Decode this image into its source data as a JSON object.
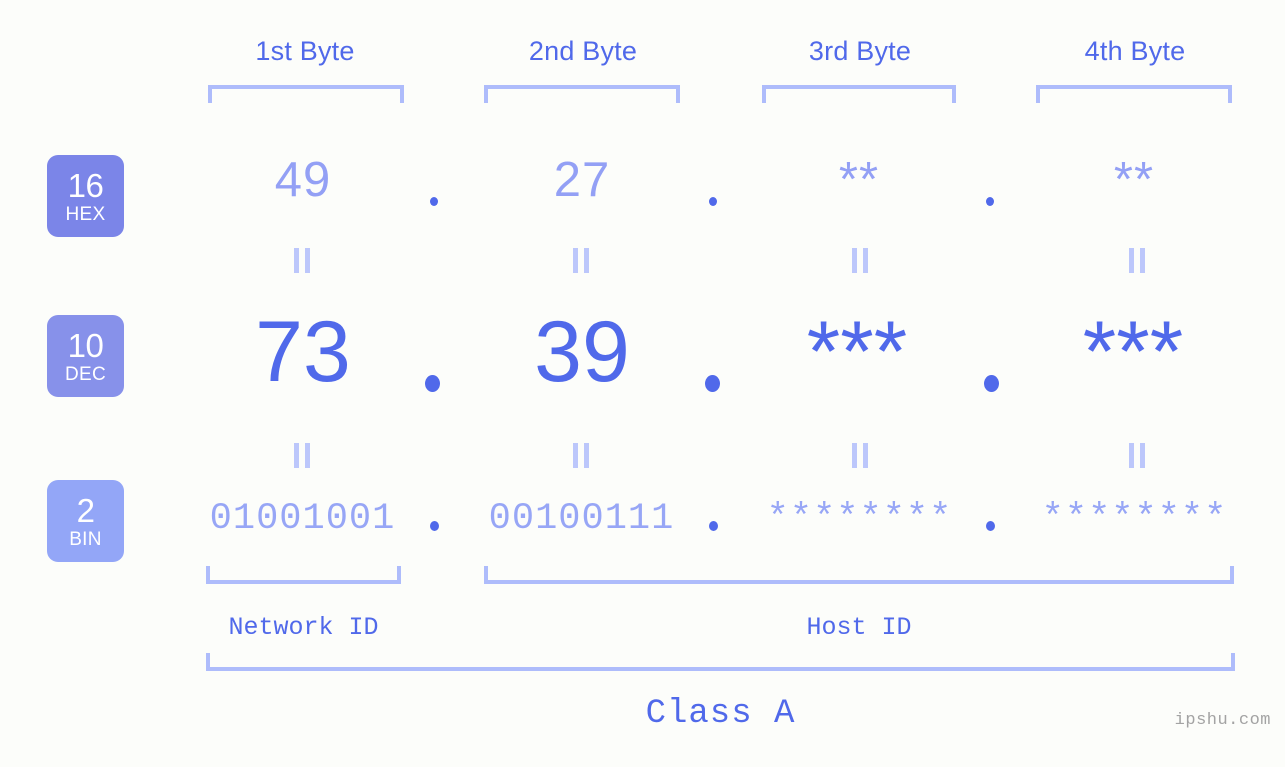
{
  "background_color": "#fcfdfa",
  "colors": {
    "accent_strong": "#5069ea",
    "accent_light": "#a8b4fb",
    "badge_hex": "#7b85e8",
    "badge_dec": "#8791ea",
    "badge_bin": "#93a6f7",
    "bracket": "#aebcfb",
    "equals_mark": "#bcc7fb",
    "watermark": "#a3a3a3"
  },
  "byte_headers": [
    {
      "label": "1st Byte"
    },
    {
      "label": "2nd Byte"
    },
    {
      "label": "3rd Byte"
    },
    {
      "label": "4th Byte"
    }
  ],
  "rows": [
    {
      "id": "hex",
      "badge_number": "16",
      "badge_name": "HEX",
      "values": [
        "49",
        "27",
        "**",
        "**"
      ],
      "separator": "."
    },
    {
      "id": "dec",
      "badge_number": "10",
      "badge_name": "DEC",
      "values": [
        "73",
        "39",
        "***",
        "***"
      ],
      "separator": "."
    },
    {
      "id": "bin",
      "badge_number": "2",
      "badge_name": "BIN",
      "values": [
        "01001001",
        "00100111",
        "********",
        "********"
      ],
      "separator": "."
    }
  ],
  "equals_symbol": "||",
  "sections": {
    "network_id": "Network ID",
    "host_id": "Host ID",
    "class": "Class A"
  },
  "watermark": "ipshu.com"
}
